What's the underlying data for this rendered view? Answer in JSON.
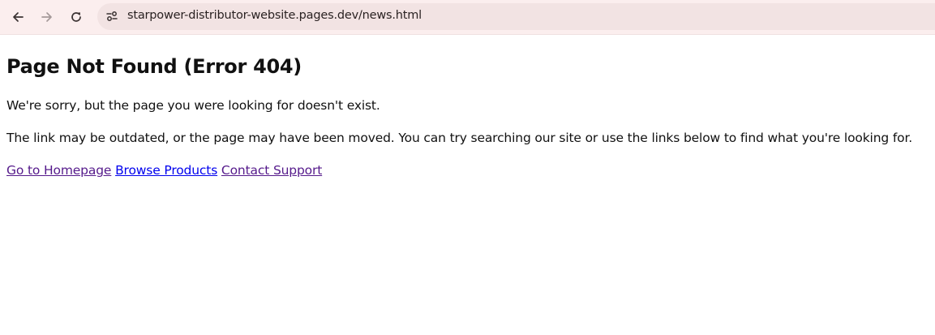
{
  "browser": {
    "url": "starpower-distributor-website.pages.dev/news.html",
    "icons": {
      "back": "arrow-left-icon",
      "forward": "arrow-right-icon",
      "reload": "reload-icon",
      "site_info": "tune-icon"
    }
  },
  "page": {
    "title": "Page Not Found (Error 404)",
    "paragraphs": [
      "We're sorry, but the page you were looking for doesn't exist.",
      "The link may be outdated, or the page may have been moved. You can try searching our site or use the links below to find what you're looking for."
    ],
    "links": [
      {
        "label": "Go to Homepage"
      },
      {
        "label": "Browse Products"
      },
      {
        "label": "Contact Support"
      }
    ]
  },
  "colors": {
    "toolbar_bg": "#fbeeee",
    "omnibox_bg": "#f2e3e3",
    "link": "#0000ee",
    "link_visited": "#551a8b"
  }
}
